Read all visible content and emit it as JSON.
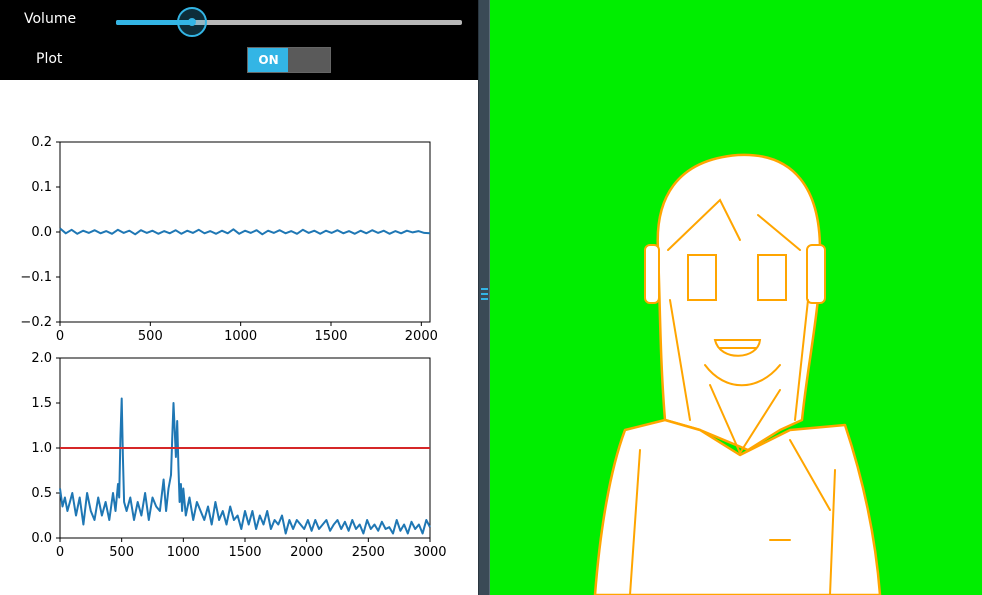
{
  "controls": {
    "volume_label": "Volume",
    "volume_value": 0.22,
    "plot_label": "Plot",
    "plot_toggle_label": "ON",
    "plot_toggle_on": true
  },
  "colors": {
    "accent": "#33b5e5",
    "series": "#1f77b4",
    "threshold": "#d62728",
    "canvas_bg": "#00ee00",
    "sketch": "#ffa500"
  },
  "icons": {
    "divider_grip": "drag-handle-icon"
  },
  "chart_data": [
    {
      "type": "line",
      "xlim": [
        0,
        2048
      ],
      "ylim": [
        -0.2,
        0.2
      ],
      "x_ticks": [
        "0",
        "500",
        "1000",
        "1500",
        "2000"
      ],
      "y_ticks": [
        "0.2",
        "0.1",
        "0.0",
        "−0.1",
        "−0.2"
      ],
      "x_tick_values": [
        0,
        500,
        1000,
        1500,
        2000
      ],
      "y_tick_values": [
        0.2,
        0.1,
        0.0,
        -0.1,
        -0.2
      ],
      "grid": false,
      "series": [
        {
          "x": [
            0,
            32,
            64,
            96,
            128,
            160,
            192,
            224,
            256,
            288,
            320,
            352,
            384,
            416,
            448,
            480,
            512,
            544,
            576,
            608,
            640,
            672,
            704,
            736,
            768,
            800,
            832,
            864,
            896,
            928,
            960,
            992,
            1024,
            1056,
            1088,
            1120,
            1152,
            1184,
            1216,
            1248,
            1280,
            1312,
            1344,
            1376,
            1408,
            1440,
            1472,
            1504,
            1536,
            1568,
            1600,
            1632,
            1664,
            1696,
            1728,
            1760,
            1792,
            1824,
            1856,
            1888,
            1920,
            1952,
            1984,
            2016,
            2048
          ],
          "y": [
            0.008,
            -0.003,
            0.005,
            -0.004,
            0.003,
            -0.002,
            0.004,
            -0.003,
            0.002,
            -0.004,
            0.005,
            -0.002,
            0.003,
            -0.005,
            0.004,
            -0.002,
            0.003,
            -0.004,
            0.002,
            -0.003,
            0.004,
            -0.004,
            0.003,
            -0.002,
            0.005,
            -0.003,
            0.002,
            -0.004,
            0.003,
            -0.003,
            0.006,
            -0.004,
            0.003,
            -0.002,
            0.004,
            -0.005,
            0.003,
            -0.002,
            0.004,
            -0.003,
            0.002,
            -0.004,
            0.005,
            -0.002,
            0.003,
            -0.004,
            0.003,
            -0.002,
            0.004,
            -0.003,
            0.002,
            -0.004,
            0.003,
            -0.003,
            0.004,
            -0.002,
            0.003,
            -0.004,
            0.002,
            -0.003,
            0.003,
            -0.001,
            0.002,
            -0.002,
            -0.003
          ]
        }
      ]
    },
    {
      "type": "line",
      "xlim": [
        0,
        3000
      ],
      "ylim": [
        0.0,
        2.0
      ],
      "x_ticks": [
        "0",
        "500",
        "1000",
        "1500",
        "2000",
        "2500",
        "3000"
      ],
      "y_ticks": [
        "2.0",
        "1.5",
        "1.0",
        "0.5",
        "0.0"
      ],
      "x_tick_values": [
        0,
        500,
        1000,
        1500,
        2000,
        2500,
        3000
      ],
      "y_tick_values": [
        2.0,
        1.5,
        1.0,
        0.5,
        0.0
      ],
      "grid": false,
      "threshold": 1.0,
      "series": [
        {
          "x": [
            0,
            20,
            40,
            60,
            80,
            100,
            130,
            160,
            190,
            220,
            250,
            280,
            310,
            340,
            370,
            400,
            430,
            450,
            470,
            480,
            490,
            500,
            510,
            520,
            540,
            570,
            600,
            630,
            660,
            690,
            720,
            750,
            780,
            810,
            840,
            860,
            880,
            900,
            910,
            920,
            930,
            940,
            950,
            960,
            970,
            980,
            990,
            1000,
            1020,
            1050,
            1080,
            1110,
            1140,
            1170,
            1200,
            1230,
            1260,
            1290,
            1320,
            1350,
            1380,
            1410,
            1440,
            1470,
            1500,
            1530,
            1560,
            1590,
            1620,
            1650,
            1680,
            1710,
            1740,
            1770,
            1800,
            1830,
            1860,
            1890,
            1920,
            1950,
            1980,
            2010,
            2040,
            2070,
            2100,
            2130,
            2160,
            2190,
            2220,
            2250,
            2280,
            2310,
            2340,
            2370,
            2400,
            2430,
            2460,
            2490,
            2520,
            2550,
            2580,
            2610,
            2640,
            2670,
            2700,
            2730,
            2760,
            2790,
            2820,
            2850,
            2880,
            2910,
            2940,
            2970,
            3000
          ],
          "y": [
            0.55,
            0.35,
            0.45,
            0.3,
            0.4,
            0.5,
            0.25,
            0.45,
            0.15,
            0.5,
            0.3,
            0.2,
            0.45,
            0.25,
            0.4,
            0.2,
            0.5,
            0.3,
            0.6,
            0.45,
            1.1,
            1.55,
            0.9,
            0.4,
            0.3,
            0.45,
            0.2,
            0.4,
            0.25,
            0.5,
            0.2,
            0.45,
            0.35,
            0.3,
            0.65,
            0.3,
            0.55,
            0.7,
            1.1,
            1.5,
            1.2,
            0.9,
            1.3,
            0.8,
            0.4,
            0.6,
            0.3,
            0.55,
            0.25,
            0.45,
            0.2,
            0.4,
            0.3,
            0.2,
            0.35,
            0.15,
            0.4,
            0.2,
            0.3,
            0.15,
            0.35,
            0.2,
            0.25,
            0.1,
            0.3,
            0.15,
            0.3,
            0.1,
            0.25,
            0.15,
            0.3,
            0.1,
            0.2,
            0.15,
            0.25,
            0.05,
            0.2,
            0.1,
            0.2,
            0.15,
            0.1,
            0.2,
            0.08,
            0.2,
            0.1,
            0.15,
            0.2,
            0.08,
            0.15,
            0.2,
            0.1,
            0.18,
            0.08,
            0.2,
            0.1,
            0.15,
            0.05,
            0.2,
            0.1,
            0.15,
            0.08,
            0.18,
            0.1,
            0.12,
            0.05,
            0.2,
            0.08,
            0.15,
            0.05,
            0.18,
            0.1,
            0.15,
            0.05,
            0.2,
            0.12
          ]
        }
      ]
    }
  ]
}
